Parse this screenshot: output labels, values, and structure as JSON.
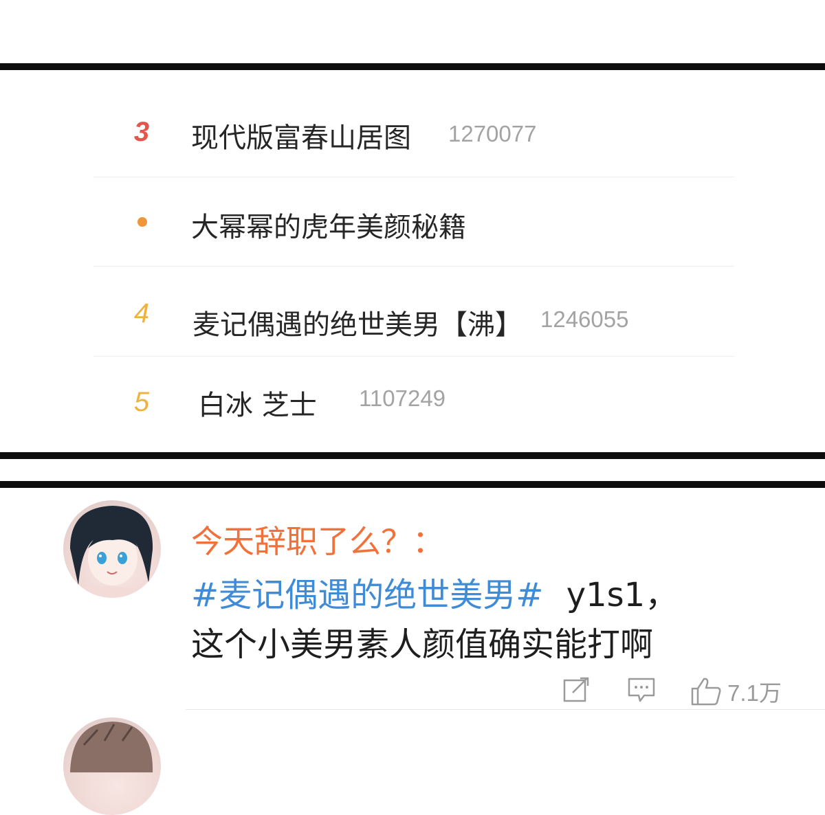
{
  "trending": {
    "items": [
      {
        "rank": "3",
        "title": "现代版富春山居图",
        "heat": "1270077"
      },
      {
        "rank": "",
        "title": "大幂幂的虎年美颜秘籍",
        "heat": ""
      },
      {
        "rank": "4",
        "title": "麦记偶遇的绝世美男【沸】",
        "heat": "1246055"
      },
      {
        "rank": "5",
        "title": "白冰 芝士",
        "heat": "1107249"
      }
    ]
  },
  "comment": {
    "username": "今天辞职了么？：",
    "hashtag": "#麦记偶遇的绝世美男#",
    "text_after_hashtag": "y1s1，",
    "text_line2": "这个小美男素人颜值确实能打啊",
    "likes": "7.1万"
  },
  "icons": {
    "repost": "repost-icon",
    "comment": "comment-icon",
    "like": "thumbs-up-icon",
    "promoted_dot": "dot-icon"
  },
  "colors": {
    "rank_hot": "#e2574c",
    "rank_normal": "#f0b23f",
    "promoted_dot": "#f0963a",
    "username": "#f2713a",
    "hashtag": "#3f8bd6",
    "heat": "#a3a3a3"
  }
}
